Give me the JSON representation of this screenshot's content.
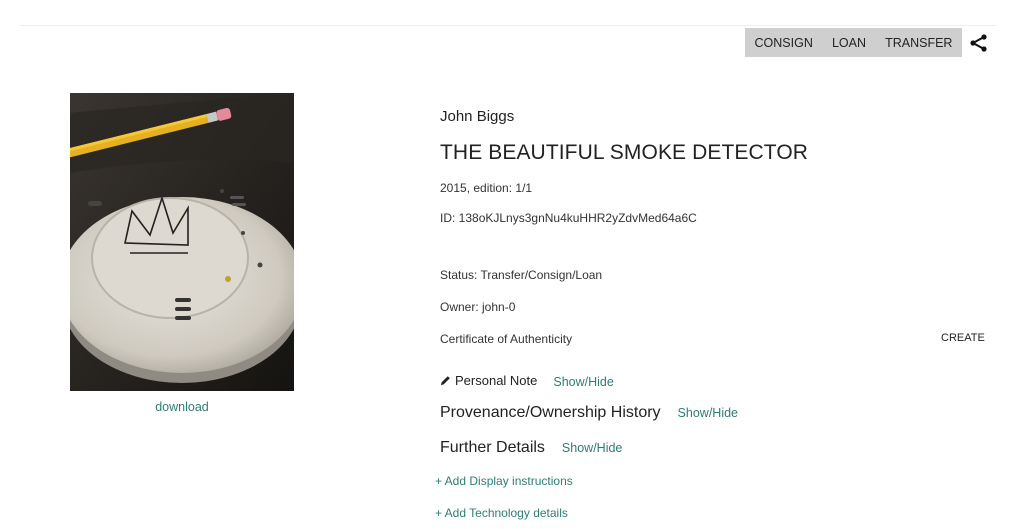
{
  "actions": {
    "consign": "CONSIGN",
    "loan": "LOAN",
    "transfer": "TRANSFER",
    "share_icon": "share-icon"
  },
  "artwork": {
    "image_icon": "smoke-detector-photo",
    "download_label": "download",
    "artist": "John Biggs",
    "title": "THE BEAUTIFUL SMOKE DETECTOR",
    "edition": "2015, edition: 1/1",
    "id": "ID: 138oKJLnys3gnNu4kuHHR2yZdvMed64a6C",
    "status": "Status: Transfer/Consign/Loan",
    "owner": "Owner: john-0",
    "coa_label": "Certificate of Authenticity",
    "coa_action": "CREATE"
  },
  "sections": {
    "personal_note_label": "Personal Note",
    "personal_note_toggle": "Show/Hide",
    "provenance_label": "Provenance/Ownership History",
    "provenance_toggle": "Show/Hide",
    "further_label": "Further Details",
    "further_toggle": "Show/Hide",
    "add_display": "+ Add Display instructions",
    "add_technology": "+ Add Technology details"
  },
  "colors": {
    "accent_link": "#2e7d74",
    "action_bar_bg": "#cfcfcf"
  }
}
